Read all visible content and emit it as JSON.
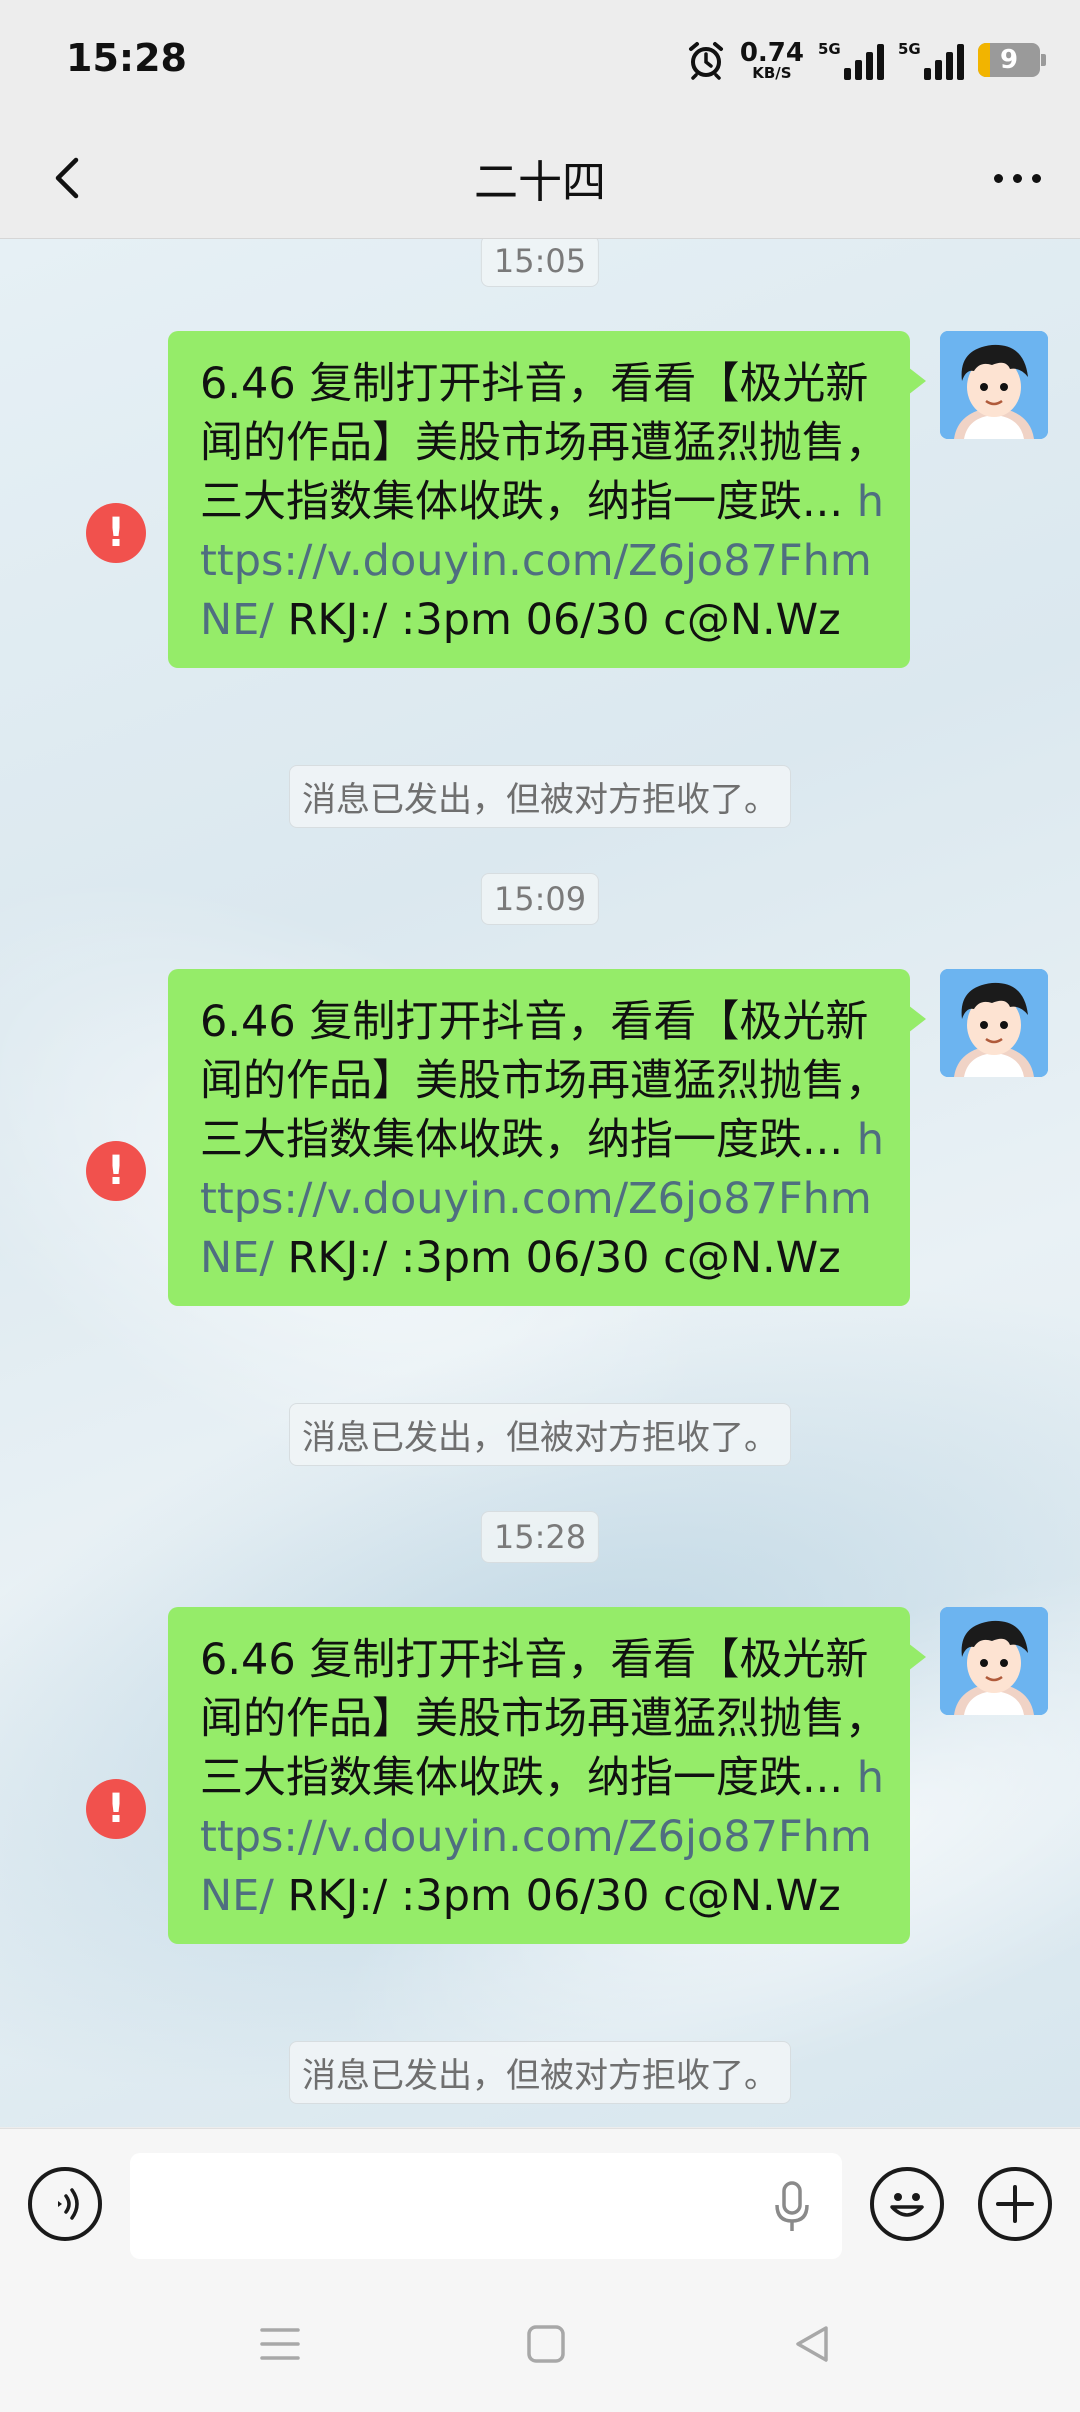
{
  "status_bar": {
    "time": "15:28",
    "net_speed_value": "0.74",
    "net_speed_unit": "KB/S",
    "signal1_label": "5G",
    "signal2_label": "5G",
    "battery": "9"
  },
  "header": {
    "title": "二十四"
  },
  "messages": [
    {
      "timestamp": "15:05",
      "text_before": "6.46 复制打开抖音，看看【极光新闻的作品】美股市场再遭猛烈抛售，三大指数集体收跌，纳指一度跌... ",
      "link": "https://v.douyin.com/Z6jo87FhmNE/",
      "text_after": " RKJ:/ :3pm 06/30 c@N.Wz",
      "status": "消息已发出，但被对方拒收了。",
      "error_glyph": "!"
    },
    {
      "timestamp": "15:09",
      "text_before": "6.46 复制打开抖音，看看【极光新闻的作品】美股市场再遭猛烈抛售，三大指数集体收跌，纳指一度跌... ",
      "link": "https://v.douyin.com/Z6jo87FhmNE/",
      "text_after": " RKJ:/ :3pm 06/30 c@N.Wz",
      "status": "消息已发出，但被对方拒收了。",
      "error_glyph": "!"
    },
    {
      "timestamp": "15:28",
      "text_before": "6.46 复制打开抖音，看看【极光新闻的作品】美股市场再遭猛烈抛售，三大指数集体收跌，纳指一度跌... ",
      "link": "https://v.douyin.com/Z6jo87FhmNE/",
      "text_after": " RKJ:/ :3pm 06/30 c@N.Wz",
      "status": "消息已发出，但被对方拒收了。",
      "error_glyph": "!"
    }
  ],
  "colors": {
    "bubble": "#95ec69",
    "error": "#f1514d",
    "link": "#4f6e80",
    "avatar_bg": "#6cb4f0"
  },
  "icons": {
    "back": "chevron-left-icon",
    "more": "more-dots-icon",
    "voice": "voice-icon",
    "mic": "mic-icon",
    "emoji": "emoji-icon",
    "plus": "plus-icon",
    "alarm": "alarm-icon"
  }
}
